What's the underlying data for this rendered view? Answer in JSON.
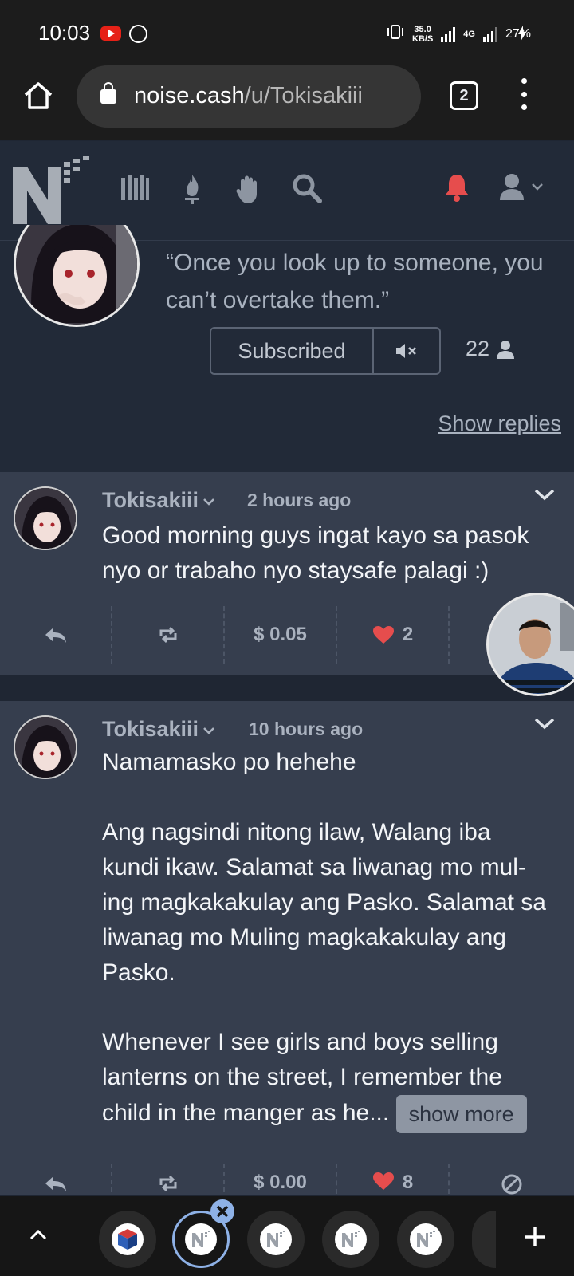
{
  "status_bar": {
    "time": "10:03",
    "speed_value": "35.0",
    "speed_unit": "KB/S",
    "network": "4G",
    "battery": "27%"
  },
  "browser": {
    "url_domain": "noise.cash",
    "url_path": "/u/Tokisakiii",
    "tab_count": "2"
  },
  "site_nav": {
    "icons": [
      "library-icon",
      "fire-icon",
      "hand-icon",
      "search-icon",
      "bell-icon",
      "user-icon"
    ],
    "accent_color": "#e64d4d"
  },
  "profile": {
    "quote": "“Once you look up to someone, you can’t overtake them.”",
    "subscribe_label": "Subscribed",
    "subscriber_count": "22",
    "show_replies": "Show replies"
  },
  "posts": [
    {
      "author": "Tokisakiii",
      "time": "2 hours ago",
      "body": "Good morning guys ingat kayo sa pasok nyo or trabaho nyo staysafe palagi :)",
      "tip": "$ 0.05",
      "likes": "2"
    },
    {
      "author": "Tokisakiii",
      "time": "10 hours ago",
      "body_paragraphs": [
        "Namamasko po hehehe",
        "Ang nagsindi nitong ilaw, Walang iba kundi ikaw. Salamat sa liwanag mo mul-ing magkakakulay ang Pasko. Salamat sa liwanag mo Muling magkakakulay ang Pasko.",
        "Whenever I see girls and boys selling lanterns on the street, I remember the child in the manger as he..."
      ],
      "show_more": "show more",
      "tip": "$ 0.00",
      "likes": "8"
    }
  ]
}
